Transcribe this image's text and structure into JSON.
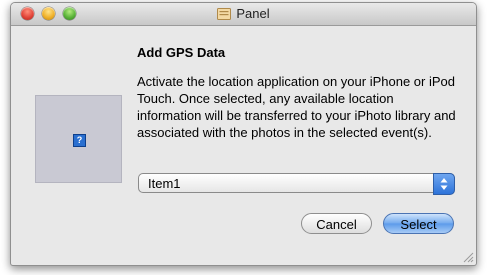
{
  "window": {
    "title": "Panel",
    "icons": {
      "close": "close-button",
      "minimize": "minimize-button",
      "zoom": "zoom-button",
      "title": "document-icon"
    },
    "colors": {
      "accent": "#5b9aea",
      "close": "#e2463a",
      "minimize": "#f0b22b",
      "zoom": "#5bb43a"
    }
  },
  "dialog": {
    "heading": "Add GPS Data",
    "message": "Activate the location application on your iPhone or iPod Touch. Once selected, any available location information will be transferred to your iPhoto library and associated with the photos in the selected event(s).",
    "image_icon": "question-mark-icon",
    "image_icon_glyph": "?",
    "popup": {
      "selected": "Item1"
    },
    "buttons": {
      "cancel": "Cancel",
      "select": "Select"
    }
  }
}
